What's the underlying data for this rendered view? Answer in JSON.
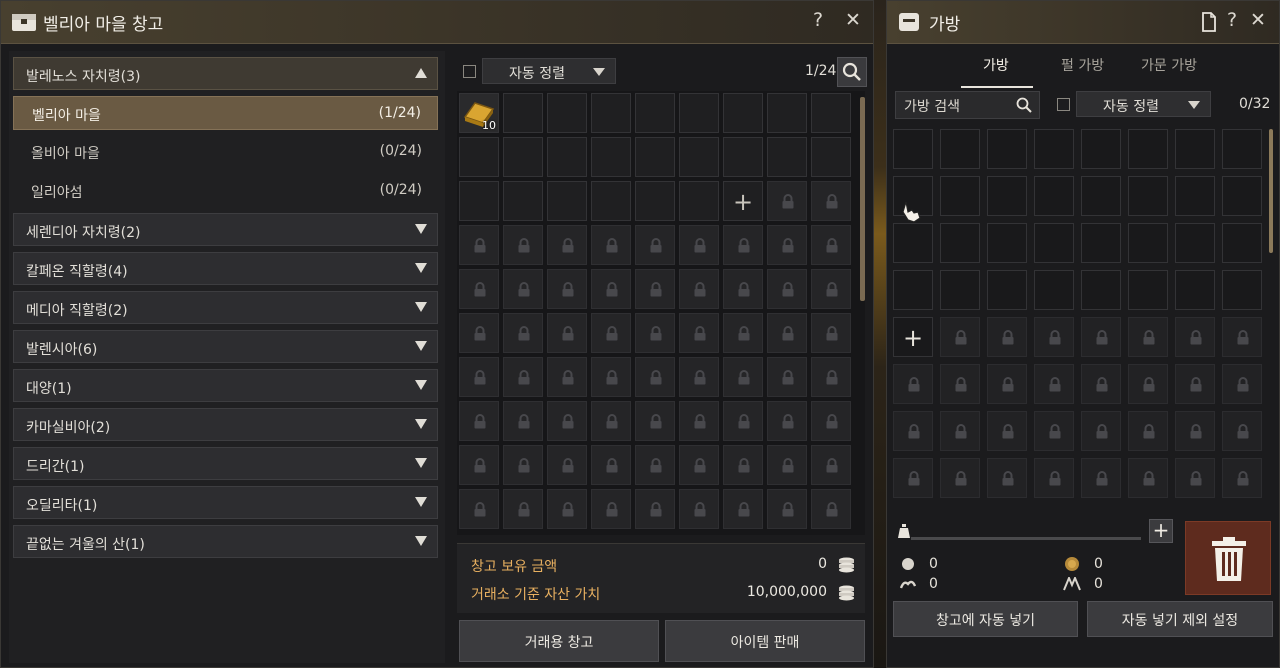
{
  "warehouse": {
    "title": "벨리아 마을 창고",
    "help": "?",
    "close": "✕",
    "regions": [
      {
        "label": "발레노스 자치령(3)",
        "open": true
      },
      {
        "label": "세렌디아 자치령(2)"
      },
      {
        "label": "칼페온 직할령(4)"
      },
      {
        "label": "메디아 직할령(2)"
      },
      {
        "label": "발렌시아(6)"
      },
      {
        "label": "대양(1)"
      },
      {
        "label": "카마실비아(2)"
      },
      {
        "label": "드리간(1)"
      },
      {
        "label": "오딜리타(1)"
      },
      {
        "label": "끝없는 겨울의 산(1)"
      }
    ],
    "towns": [
      {
        "name": "벨리아 마을",
        "count": "(1/24)",
        "selected": true
      },
      {
        "name": "올비아 마을",
        "count": "(0/24)"
      },
      {
        "name": "일리야섬",
        "count": "(0/24)"
      }
    ],
    "sort_label": "자동 정렬",
    "capacity": "1/24",
    "item_count": "10",
    "money_label": "창고 보유 금액",
    "money_value": "0",
    "asset_label": "거래소 기준 자산 가치",
    "asset_value": "10,000,000",
    "btn_trade": "거래용 창고",
    "btn_sell": "아이템 판매",
    "colors": {
      "accent": "#e8b060",
      "selected": "#6a5a43"
    }
  },
  "bag": {
    "title": "가방",
    "help": "?",
    "close": "✕",
    "tabs": [
      "가방",
      "펄 가방",
      "가문 가방"
    ],
    "search_placeholder": "가방 검색",
    "sort_label": "자동 정렬",
    "capacity": "0/32",
    "stats": {
      "silver": "0",
      "weight": "0",
      "energy": "0",
      "contribution": "0"
    },
    "btn_auto_store": "창고에 자동 넣기",
    "btn_exclude": "자동 넣기 제외 설정"
  }
}
